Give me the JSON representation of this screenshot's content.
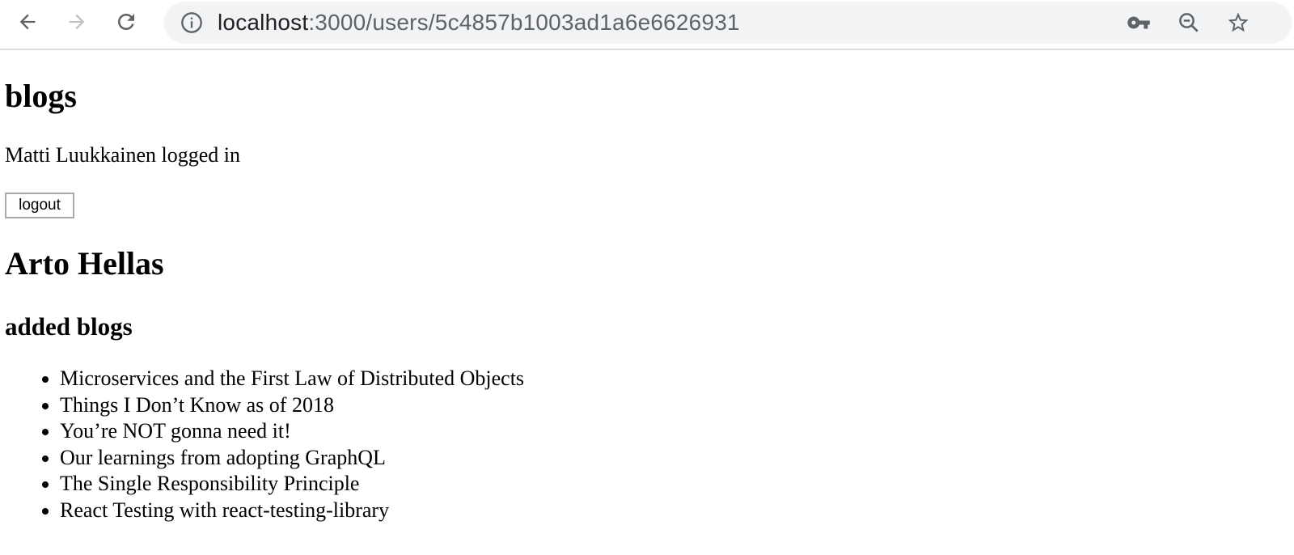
{
  "browser": {
    "url_host": "localhost",
    "url_rest": ":3000/users/5c4857b1003ad1a6e6626931"
  },
  "page": {
    "title": "blogs",
    "logged_in_text": "Matti Luukkainen logged in",
    "logout_label": "logout",
    "user_name": "Arto Hellas",
    "added_blogs_heading": "added blogs",
    "blogs": [
      "Microservices and the First Law of Distributed Objects",
      "Things I Don’t Know as of 2018",
      "You’re NOT gonna need it!",
      "Our learnings from adopting GraphQL",
      "The Single Responsibility Principle",
      "React Testing with react-testing-library"
    ]
  },
  "icons": {
    "back": "arrow-left-icon",
    "forward": "arrow-right-icon",
    "reload": "reload-icon",
    "info": "info-icon",
    "key": "key-icon",
    "zoom": "zoom-out-icon",
    "bookmark": "star-icon"
  },
  "colors": {
    "toolbar_bg": "#ffffff",
    "omnibox_bg": "#f1f3f4",
    "icon_dark": "#5f6368",
    "icon_disabled": "#bdc1c6",
    "url_host": "#202124",
    "url_rest": "#5f6368"
  }
}
